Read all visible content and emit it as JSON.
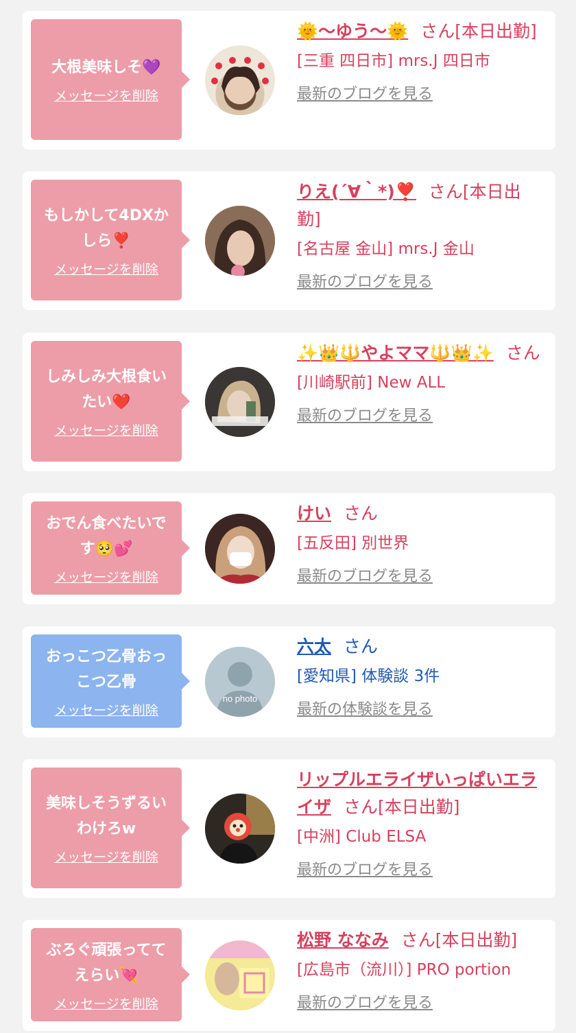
{
  "messages": [
    {
      "bubble_text": "大根美味しそ💜",
      "delete_label": "メッセージを削除",
      "name": "🌞〜ゆう〜🌞",
      "suffix": "さん[本日出勤]",
      "location": "[三重 四日市] mrs.J 四日市",
      "blog_link": "最新のブログを見る"
    },
    {
      "bubble_text": "もしかして4DXかしら❣️",
      "delete_label": "メッセージを削除",
      "name": "りえ(´∀｀*)❣️",
      "suffix": "さん[本日出勤]",
      "location": "[名古屋 金山] mrs.J 金山",
      "blog_link": "最新のブログを見る"
    },
    {
      "bubble_text": "しみしみ大根食いたい❤️",
      "delete_label": "メッセージを削除",
      "name": "✨👑🔱やよママ🔱👑✨",
      "suffix": "さん",
      "location": "[川崎駅前] New ALL",
      "blog_link": "最新のブログを見る"
    },
    {
      "bubble_text": "おでん食べたいです🥺💕",
      "delete_label": "メッセージを削除",
      "name": "けい",
      "suffix": "さん",
      "location": "[五反田] 別世界",
      "blog_link": "最新のブログを見る"
    },
    {
      "bubble_text": "おっこつ乙骨おっこつ乙骨",
      "delete_label": "メッセージを削除",
      "name": "六太",
      "suffix": "さん",
      "location": "[愛知県] 体験談 3件",
      "blog_link": "最新の体験談を見る",
      "avatar_text": "no photo"
    },
    {
      "bubble_text": "美味しそうずるいわけろw",
      "delete_label": "メッセージを削除",
      "name": "リップルエライザいっぱいエライザ",
      "suffix": "さん[本日出勤]",
      "location": "[中洲] Club ELSA",
      "blog_link": "最新のブログを見る"
    },
    {
      "bubble_text": "ぶろぐ頑張っててえらい💘",
      "delete_label": "メッセージを削除",
      "name": "松野 ななみ",
      "suffix": "さん[本日出勤]",
      "location": "[広島市（流川）] PRO portion",
      "blog_link": "最新のブログを見る"
    }
  ],
  "colors": {
    "pink_bubble": "#ec9da8",
    "blue_bubble": "#8cb4ee",
    "pink_text": "#d6405d",
    "blue_text": "#1f5ab5",
    "link_gray": "#8a8a8a",
    "background": "#f2f2f2"
  }
}
